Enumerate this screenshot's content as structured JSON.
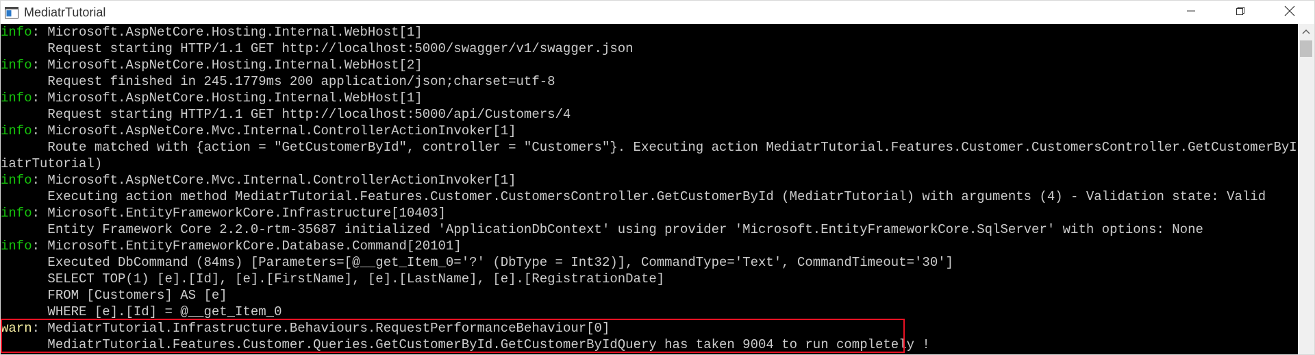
{
  "window": {
    "title": "MediatrTutorial"
  },
  "console": {
    "lines": [
      {
        "level": "info",
        "sep": ": ",
        "text": "Microsoft.AspNetCore.Hosting.Internal.WebHost[1]"
      },
      {
        "level": "",
        "sep": "",
        "text": "      Request starting HTTP/1.1 GET http://localhost:5000/swagger/v1/swagger.json"
      },
      {
        "level": "info",
        "sep": ": ",
        "text": "Microsoft.AspNetCore.Hosting.Internal.WebHost[2]"
      },
      {
        "level": "",
        "sep": "",
        "text": "      Request finished in 245.1779ms 200 application/json;charset=utf-8"
      },
      {
        "level": "info",
        "sep": ": ",
        "text": "Microsoft.AspNetCore.Hosting.Internal.WebHost[1]"
      },
      {
        "level": "",
        "sep": "",
        "text": "      Request starting HTTP/1.1 GET http://localhost:5000/api/Customers/4"
      },
      {
        "level": "info",
        "sep": ": ",
        "text": "Microsoft.AspNetCore.Mvc.Internal.ControllerActionInvoker[1]"
      },
      {
        "level": "",
        "sep": "",
        "text": "      Route matched with {action = \"GetCustomerById\", controller = \"Customers\"}. Executing action MediatrTutorial.Features.Customer.CustomersController.GetCustomerById (Med"
      },
      {
        "level": "",
        "sep": "",
        "text": "iatrTutorial)"
      },
      {
        "level": "info",
        "sep": ": ",
        "text": "Microsoft.AspNetCore.Mvc.Internal.ControllerActionInvoker[1]"
      },
      {
        "level": "",
        "sep": "",
        "text": "      Executing action method MediatrTutorial.Features.Customer.CustomersController.GetCustomerById (MediatrTutorial) with arguments (4) - Validation state: Valid"
      },
      {
        "level": "info",
        "sep": ": ",
        "text": "Microsoft.EntityFrameworkCore.Infrastructure[10403]"
      },
      {
        "level": "",
        "sep": "",
        "text": "      Entity Framework Core 2.2.0-rtm-35687 initialized 'ApplicationDbContext' using provider 'Microsoft.EntityFrameworkCore.SqlServer' with options: None"
      },
      {
        "level": "info",
        "sep": ": ",
        "text": "Microsoft.EntityFrameworkCore.Database.Command[20101]"
      },
      {
        "level": "",
        "sep": "",
        "text": "      Executed DbCommand (84ms) [Parameters=[@__get_Item_0='?' (DbType = Int32)], CommandType='Text', CommandTimeout='30']"
      },
      {
        "level": "",
        "sep": "",
        "text": "      SELECT TOP(1) [e].[Id], [e].[FirstName], [e].[LastName], [e].[RegistrationDate]"
      },
      {
        "level": "",
        "sep": "",
        "text": "      FROM [Customers] AS [e]"
      },
      {
        "level": "",
        "sep": "",
        "text": "      WHERE [e].[Id] = @__get_Item_0"
      },
      {
        "level": "warn",
        "sep": ": ",
        "text": "MediatrTutorial.Infrastructure.Behaviours.RequestPerformanceBehaviour[0]"
      },
      {
        "level": "",
        "sep": "",
        "text": "      MediatrTutorial.Features.Customer.Queries.GetCustomerById.GetCustomerByIdQuery has taken 9004 to run completely !"
      }
    ]
  },
  "colors": {
    "info": "#16c60c",
    "warn": "#f9f1a5",
    "text": "#cccccc",
    "highlight": "#e81123"
  }
}
